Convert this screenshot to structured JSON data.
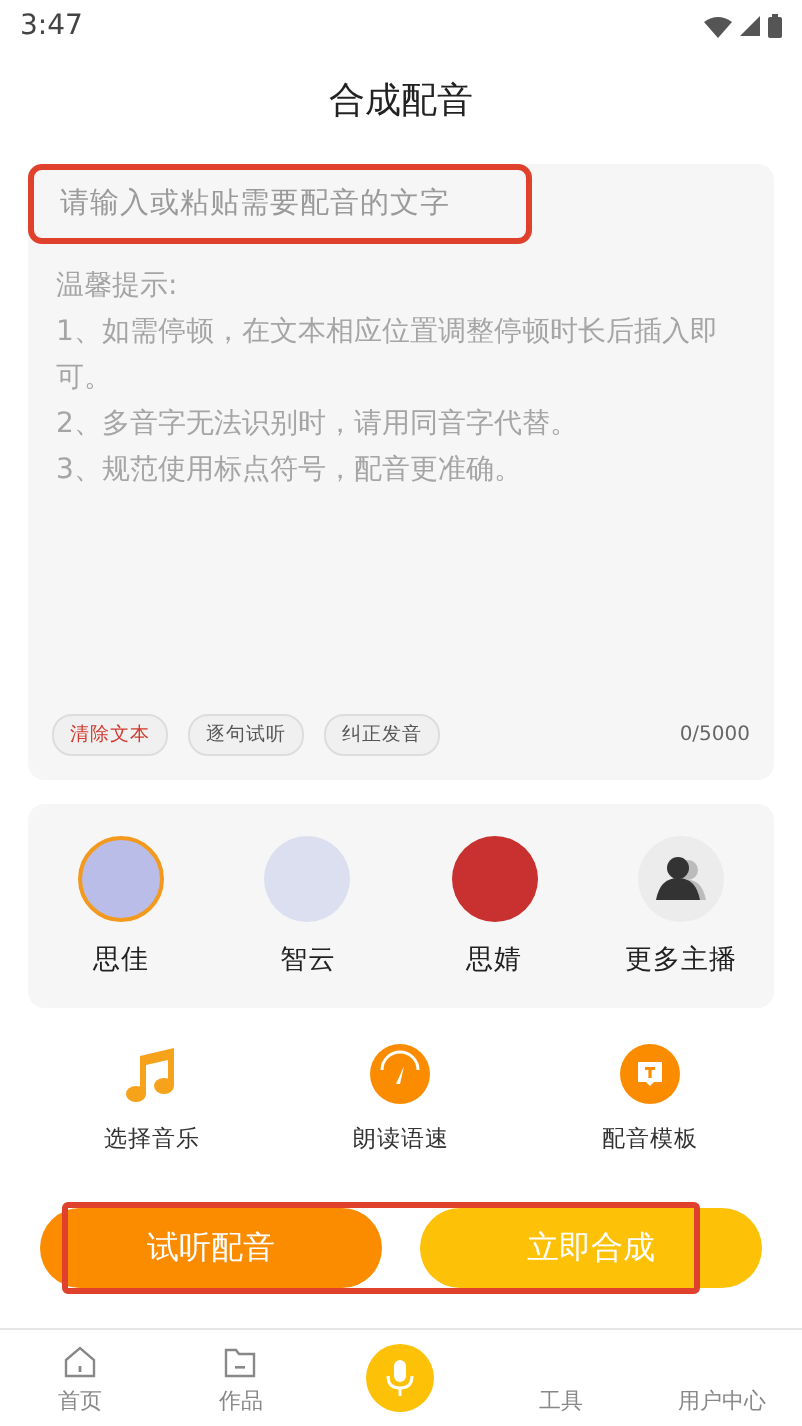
{
  "status_bar": {
    "time": "3:47"
  },
  "header": {
    "title": "合成配音"
  },
  "editor": {
    "placeholder": "请输入或粘贴需要配音的文字",
    "highlighted": true,
    "tips": [
      "温馨提示:",
      "1、如需停顿，在文本相应位置调整停顿时长后插入即可。",
      "2、多音字无法识别时，请用同音字代替。",
      "3、规范使用标点符号，配音更准确。"
    ],
    "chips": [
      {
        "label": "清除文本",
        "kind": "danger"
      },
      {
        "label": "逐句试听",
        "kind": "normal"
      },
      {
        "label": "纠正发音",
        "kind": "normal"
      }
    ],
    "counter": "0/5000"
  },
  "anchors": [
    {
      "name": "思佳",
      "kind": "avatar",
      "selected": true,
      "color": "#b9bde8"
    },
    {
      "name": "智云",
      "kind": "avatar",
      "selected": false,
      "color": "#dcdff0"
    },
    {
      "name": "思婧",
      "kind": "avatar",
      "selected": false,
      "color": "#c8312f"
    },
    {
      "name": "更多主播",
      "kind": "more",
      "selected": false,
      "color": "#ececec"
    }
  ],
  "tools": [
    {
      "label": "选择音乐",
      "kind": "music"
    },
    {
      "label": "朗读语速",
      "kind": "speed"
    },
    {
      "label": "配音模板",
      "kind": "template"
    }
  ],
  "actions": {
    "highlighted": true,
    "buttons": [
      {
        "label": "试听配音",
        "kind": "preview"
      },
      {
        "label": "立即合成",
        "kind": "synthesize"
      }
    ]
  },
  "nav": [
    {
      "label": "首页",
      "kind": "home",
      "selected": false
    },
    {
      "label": "作品",
      "kind": "works",
      "selected": false
    },
    {
      "kind": "mic"
    },
    {
      "label": "工具",
      "kind": "plain",
      "selected": false
    },
    {
      "label": "用户中心",
      "kind": "plain",
      "selected": false
    }
  ]
}
